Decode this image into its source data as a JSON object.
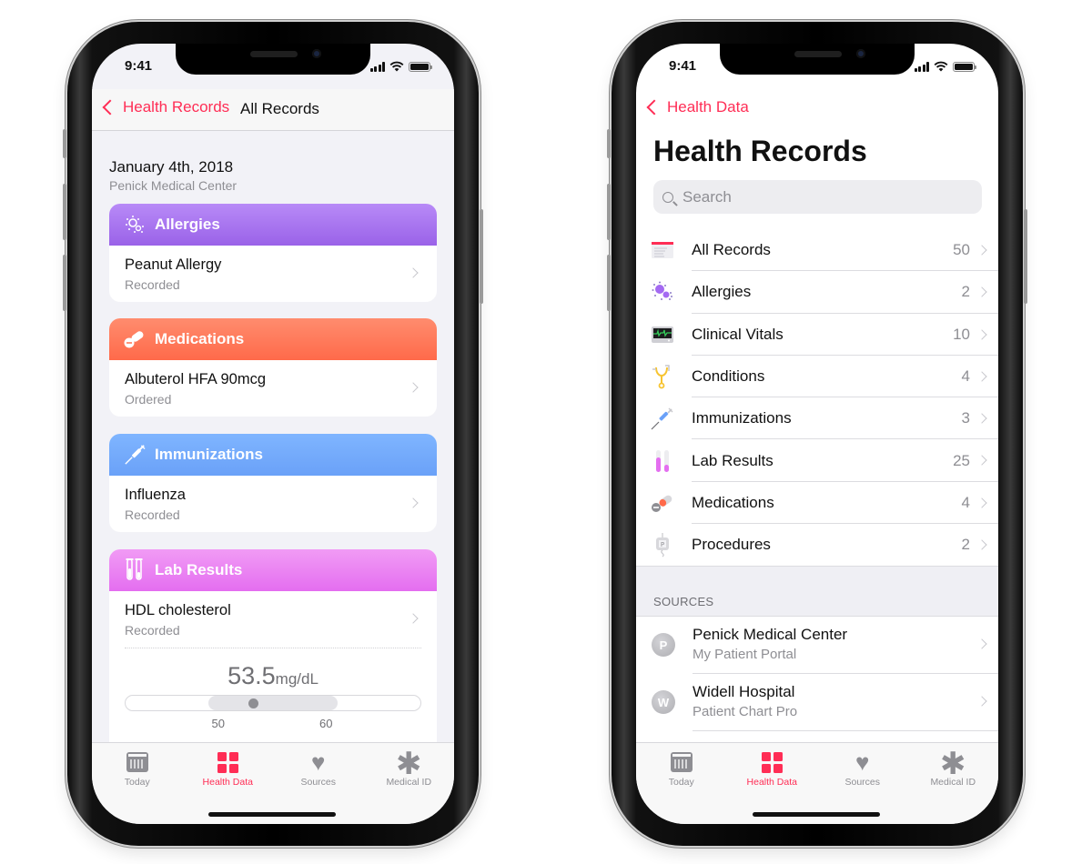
{
  "status_bar": {
    "time": "9:41"
  },
  "left_phone": {
    "nav": {
      "back_label": "Health Records",
      "title": "All Records"
    },
    "date": "January 4th, 2018",
    "source": "Penick Medical Center",
    "cards": [
      {
        "category": "Allergies",
        "icon": "allergy-icon",
        "color": "#a474f0",
        "item": "Peanut Allergy",
        "status": "Recorded"
      },
      {
        "category": "Medications",
        "icon": "pills-icon",
        "color": "#ff7a5a",
        "item": "Albuterol HFA 90mcg",
        "status": "Ordered"
      },
      {
        "category": "Immunizations",
        "icon": "syringe-icon",
        "color": "#75abfc",
        "item": "Influenza",
        "status": "Recorded"
      },
      {
        "category": "Lab Results",
        "icon": "test-tubes-icon",
        "color": "#ea85f3",
        "item": "HDL cholesterol",
        "status": "Recorded"
      }
    ],
    "lab_detail": {
      "value": "53.5",
      "unit": "mg/dL",
      "range_low_label": "50",
      "range_high_label": "60",
      "value_numeric": 53.5,
      "range_low": 50,
      "range_high": 60
    }
  },
  "right_phone": {
    "nav": {
      "back_label": "Health Data"
    },
    "title": "Health Records",
    "search": {
      "placeholder": "Search"
    },
    "records": [
      {
        "label": "All Records",
        "count": "50",
        "icon": "all-records-icon"
      },
      {
        "label": "Allergies",
        "count": "2",
        "icon": "allergy-icon"
      },
      {
        "label": "Clinical Vitals",
        "count": "10",
        "icon": "vitals-monitor-icon"
      },
      {
        "label": "Conditions",
        "count": "4",
        "icon": "stethoscope-icon"
      },
      {
        "label": "Immunizations",
        "count": "3",
        "icon": "syringe-icon"
      },
      {
        "label": "Lab Results",
        "count": "25",
        "icon": "test-tubes-icon"
      },
      {
        "label": "Medications",
        "count": "4",
        "icon": "pills-icon"
      },
      {
        "label": "Procedures",
        "count": "2",
        "icon": "procedure-icon"
      }
    ],
    "sources_header": "SOURCES",
    "sources": [
      {
        "initial": "P",
        "name": "Penick Medical Center",
        "portal": "My Patient Portal"
      },
      {
        "initial": "W",
        "name": "Widell Hospital",
        "portal": "Patient Chart Pro"
      }
    ]
  },
  "tab_bar": {
    "active_color": "#ff2d55",
    "inactive_color": "#8e8e93",
    "tabs": [
      {
        "label": "Today",
        "icon": "calendar-icon",
        "active": false
      },
      {
        "label": "Health Data",
        "icon": "health-data-grid-icon",
        "active": true
      },
      {
        "label": "Sources",
        "icon": "sources-heart-icon",
        "active": false
      },
      {
        "label": "Medical ID",
        "icon": "medical-id-asterisk-icon",
        "active": false
      }
    ]
  }
}
